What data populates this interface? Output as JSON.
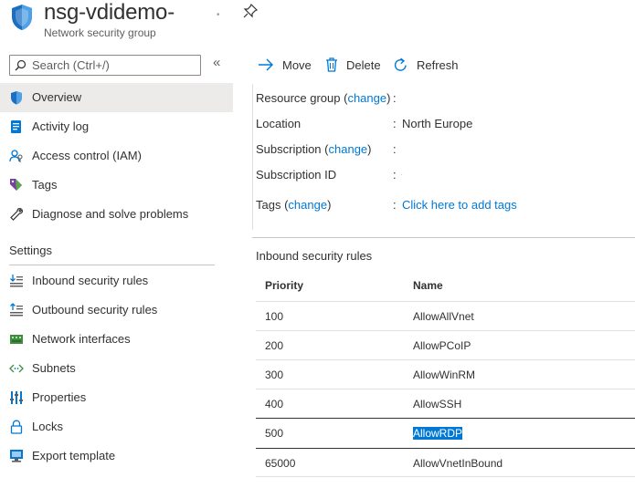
{
  "header": {
    "title": "nsg-vdidemo-",
    "subtitle": "Network security group"
  },
  "sidebar": {
    "search_placeholder": "Search (Ctrl+/)",
    "items": [
      {
        "label": "Overview",
        "icon": "shield-icon"
      },
      {
        "label": "Activity log",
        "icon": "activity-log-icon"
      },
      {
        "label": "Access control (IAM)",
        "icon": "iam-icon"
      },
      {
        "label": "Tags",
        "icon": "tag-icon"
      },
      {
        "label": "Diagnose and solve problems",
        "icon": "wrench-icon"
      }
    ],
    "settings_title": "Settings",
    "settings_items": [
      {
        "label": "Inbound security rules",
        "icon": "inbound-icon"
      },
      {
        "label": "Outbound security rules",
        "icon": "outbound-icon"
      },
      {
        "label": "Network interfaces",
        "icon": "network-interface-icon"
      },
      {
        "label": "Subnets",
        "icon": "subnet-icon"
      },
      {
        "label": "Properties",
        "icon": "properties-icon"
      },
      {
        "label": "Locks",
        "icon": "lock-icon"
      },
      {
        "label": "Export template",
        "icon": "export-template-icon"
      }
    ]
  },
  "toolbar": {
    "move": "Move",
    "delete": "Delete",
    "refresh": "Refresh"
  },
  "essentials": {
    "resource_group_label": "Resource group",
    "subscription_label": "Subscription",
    "change_link": "change",
    "location_label": "Location",
    "location_value": "North Europe",
    "subscription_id_label": "Subscription ID",
    "tags_label": "Tags",
    "tags_value": "Click here to add tags",
    "separator": ":"
  },
  "inbound": {
    "title": "Inbound security rules",
    "columns": [
      "Priority",
      "Name"
    ],
    "rows": [
      {
        "priority": "100",
        "name": "AllowAllVnet"
      },
      {
        "priority": "200",
        "name": "AllowPCoIP"
      },
      {
        "priority": "300",
        "name": "AllowWinRM"
      },
      {
        "priority": "400",
        "name": "AllowSSH"
      },
      {
        "priority": "500",
        "name": "AllowRDP",
        "selected": true
      },
      {
        "priority": "65000",
        "name": "AllowVnetInBound"
      }
    ]
  },
  "colors": {
    "accent": "#0078d4",
    "active_nav": "#edebe9",
    "text": "#323130"
  }
}
